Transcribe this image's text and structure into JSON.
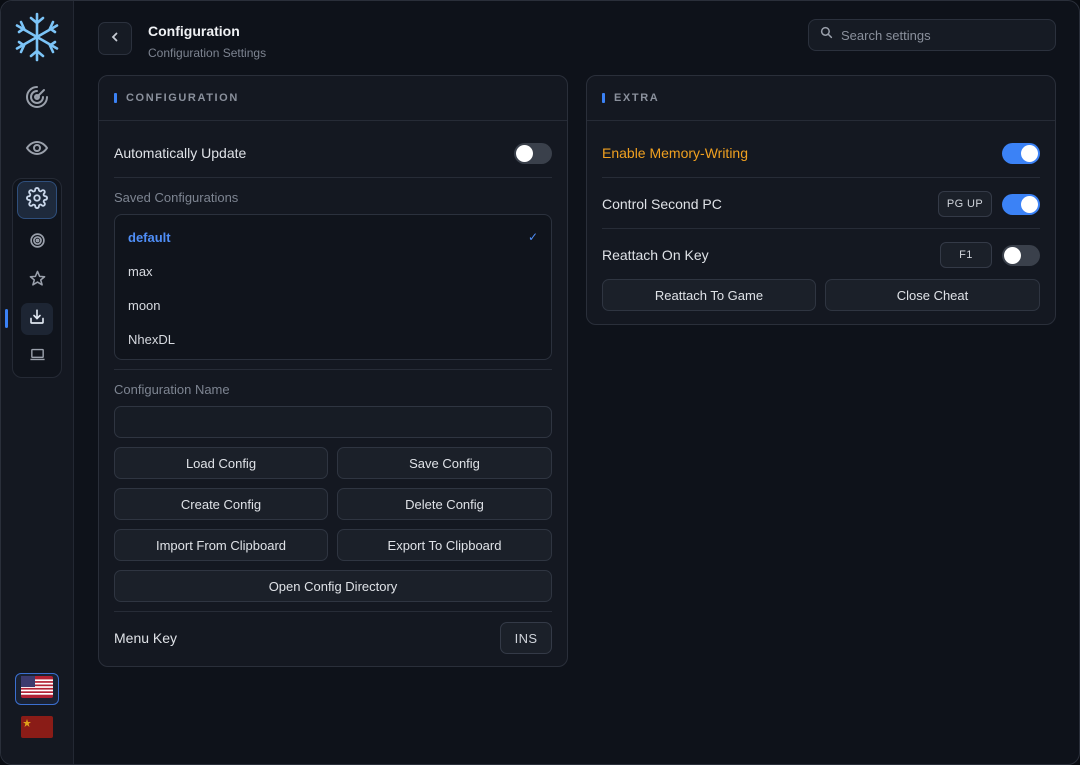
{
  "header": {
    "title": "Configuration",
    "subtitle": "Configuration Settings",
    "search_placeholder": "Search settings"
  },
  "sidebar": {
    "items": [
      {
        "icon": "radar-icon"
      },
      {
        "icon": "eye-icon"
      },
      {
        "icon": "gear-icon",
        "active": true
      },
      {
        "icon": "target-icon"
      },
      {
        "icon": "star-icon"
      },
      {
        "icon": "download-icon",
        "selected": true
      },
      {
        "icon": "laptop-icon"
      }
    ],
    "flags": [
      {
        "icon": "us-flag-icon",
        "active": true
      },
      {
        "icon": "cn-flag-icon",
        "active": false
      }
    ]
  },
  "configuration_panel": {
    "title": "CONFIGURATION",
    "auto_update_label": "Automatically Update",
    "auto_update_on": false,
    "saved_label": "Saved Configurations",
    "saved": [
      {
        "name": "default",
        "selected": true,
        "check": "✓"
      },
      {
        "name": "max"
      },
      {
        "name": "moon"
      },
      {
        "name": "NhexDL"
      }
    ],
    "name_label": "Configuration Name",
    "name_value": "",
    "buttons": {
      "load": "Load Config",
      "save": "Save Config",
      "create": "Create Config",
      "delete": "Delete Config",
      "import": "Import From Clipboard",
      "export": "Export To Clipboard",
      "open_dir": "Open Config Directory"
    },
    "menu_key_label": "Menu Key",
    "menu_key": "INS"
  },
  "extra_panel": {
    "title": "EXTRA",
    "memory_writing_label": "Enable Memory-Writing",
    "memory_writing_on": true,
    "second_pc_label": "Control Second PC",
    "second_pc_key": "PG UP",
    "second_pc_on": true,
    "reattach_key_label": "Reattach On Key",
    "reattach_key": "F1",
    "reattach_key_on": false,
    "reattach_btn": "Reattach To Game",
    "close_btn": "Close Cheat"
  },
  "colors": {
    "accent": "#3b82f6",
    "warning": "#f0a020",
    "background": "#0e121a",
    "panel": "#141821"
  }
}
